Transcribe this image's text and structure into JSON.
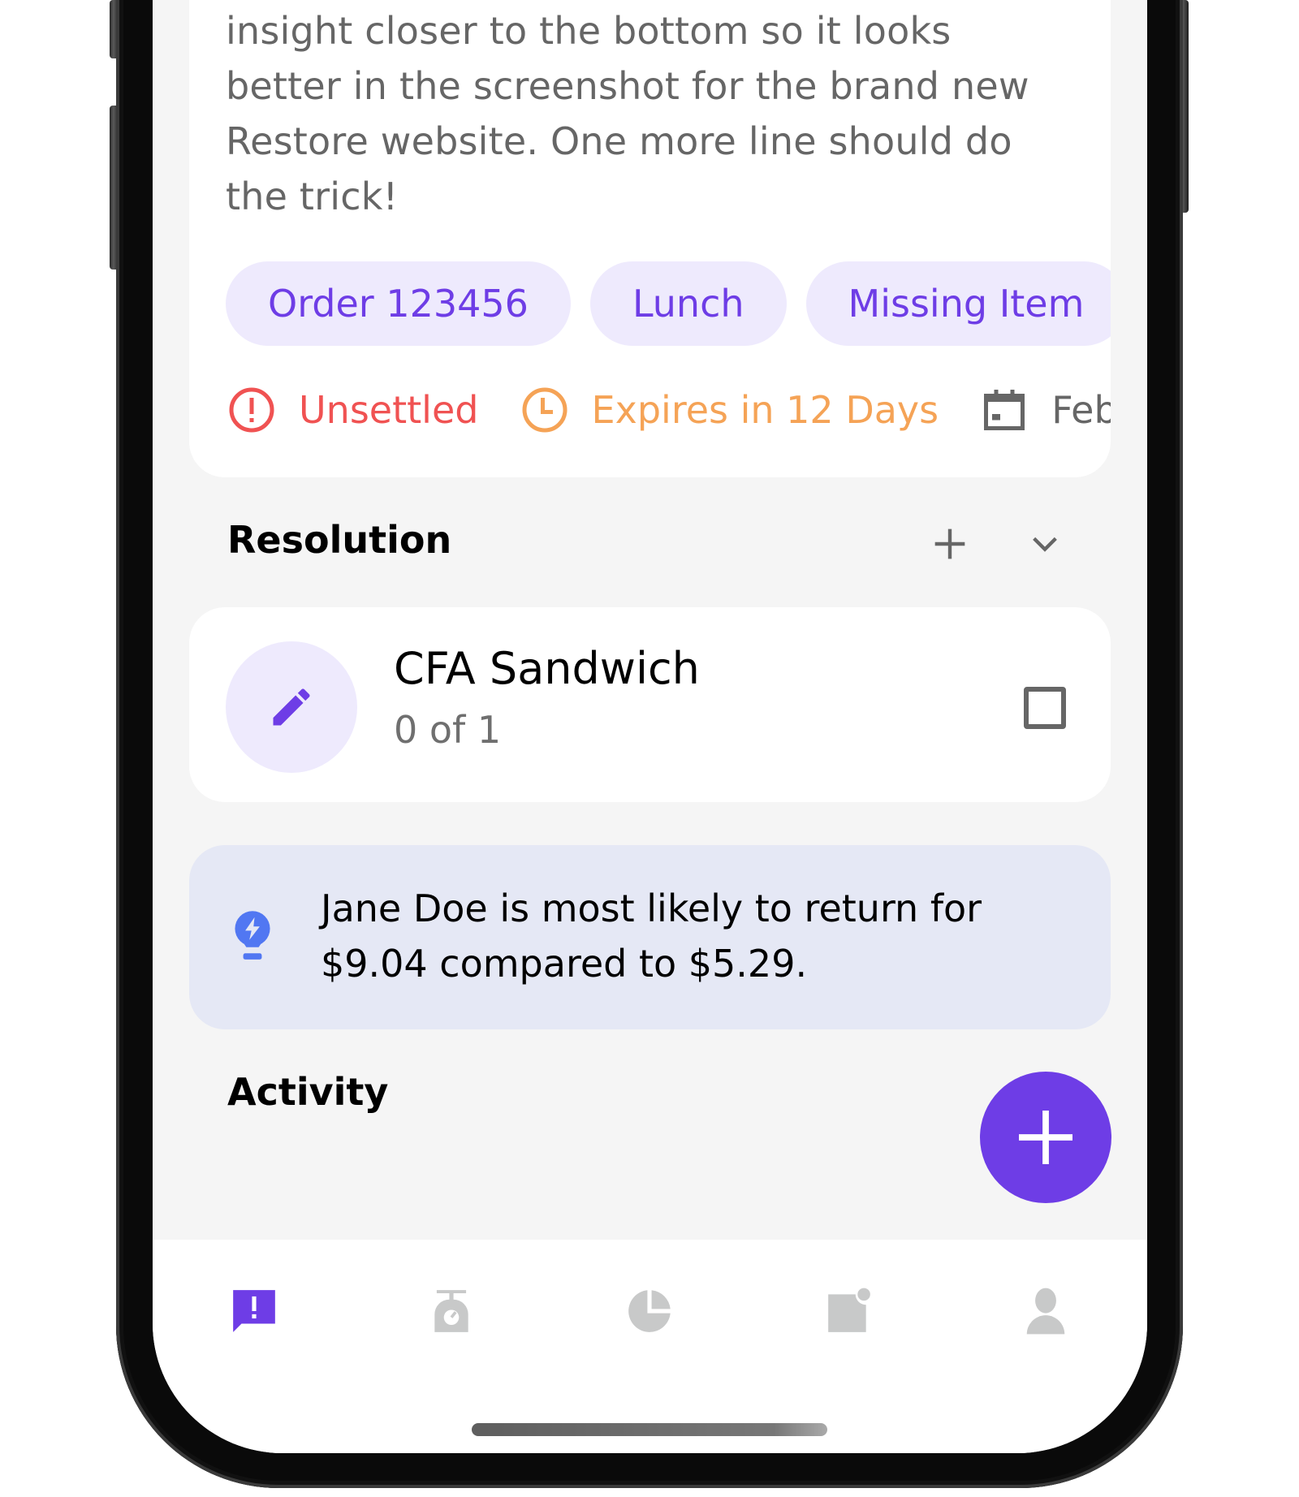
{
  "description_card": {
    "text": "insight closer to the bottom so it looks better in the screenshot for the brand new Restore website. One more line should do the trick!",
    "tags": [
      "Order 123456",
      "Lunch",
      "Missing Item"
    ],
    "statuses": [
      {
        "icon": "alert-circle-icon",
        "label": "Unsettled",
        "color": "#F05252"
      },
      {
        "icon": "clock-icon",
        "label": "Expires in 12 Days",
        "color": "#F5A356"
      },
      {
        "icon": "calendar-icon",
        "label": "Feb",
        "color": "#666666"
      }
    ]
  },
  "resolution": {
    "title": "Resolution",
    "add_icon": "plus-icon",
    "collapse_icon": "chevron-down-icon",
    "items": [
      {
        "icon": "pencil-icon",
        "title": "CFA Sandwich",
        "subtitle": "0 of 1",
        "checked": false
      }
    ]
  },
  "insight": {
    "icon": "lightbulb-bolt-icon",
    "text": "Jane Doe is most likely to return for $9.04 compared to $5.29."
  },
  "activity": {
    "title": "Activity"
  },
  "fab": {
    "icon": "plus-icon"
  },
  "bottom_nav": {
    "items": [
      {
        "name": "issues",
        "icon": "chat-alert-icon",
        "active": true
      },
      {
        "name": "scale",
        "icon": "scale-icon",
        "active": false
      },
      {
        "name": "reports",
        "icon": "pie-chart-icon",
        "active": false
      },
      {
        "name": "notes",
        "icon": "note-badge-icon",
        "active": false
      },
      {
        "name": "profile",
        "icon": "person-icon",
        "active": false
      }
    ]
  },
  "colors": {
    "accent": "#6E3DE6",
    "chip_bg": "#EEEAFD",
    "insight_bg": "#E5E8F5",
    "insight_icon": "#5177F2",
    "inactive_icon": "#C8C9C9",
    "background": "#F5F5F5"
  }
}
